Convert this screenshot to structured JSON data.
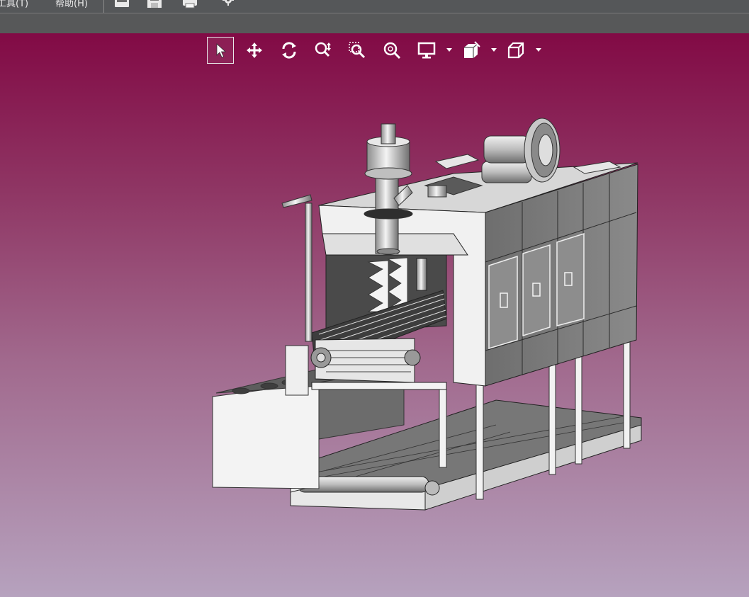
{
  "menubar": {
    "items": [
      {
        "label": "工具(T)",
        "name": "menu-tools"
      },
      {
        "label": "帮助(H)",
        "name": "menu-help"
      }
    ],
    "tool_icons": [
      "folder-open-icon",
      "save-icon",
      "print-icon",
      "settings-gear-icon"
    ]
  },
  "view_toolbar": {
    "buttons": [
      {
        "name": "select-pointer-button",
        "icon": "cursor-arrow-icon",
        "active": true
      },
      {
        "name": "pan-button",
        "icon": "move-arrows-icon"
      },
      {
        "name": "rotate-button",
        "icon": "rotate-icon"
      },
      {
        "name": "zoom-in-out-button",
        "icon": "zoom-updown-icon"
      },
      {
        "name": "zoom-window-button",
        "icon": "zoom-window-icon"
      },
      {
        "name": "zoom-fit-button",
        "icon": "zoom-fit-icon"
      },
      {
        "name": "display-mode-button",
        "icon": "monitor-icon",
        "dropdown": true
      },
      {
        "name": "section-view-button",
        "icon": "section-icon",
        "dropdown": true
      },
      {
        "name": "standard-views-button",
        "icon": "cube-view-icon",
        "dropdown": true
      }
    ]
  },
  "colors": {
    "viewport_top": "#820a45",
    "viewport_bottom": "#b6a2be",
    "chrome": "#555759",
    "model_steel": "#7a7a7a",
    "model_highlight": "#f2f2f2"
  }
}
